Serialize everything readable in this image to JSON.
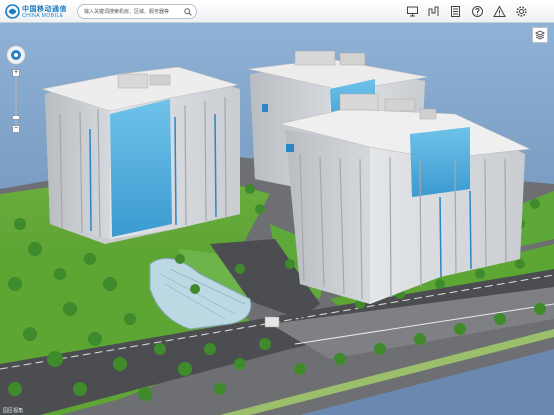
{
  "brand": {
    "name_cn": "中国移动通信",
    "name_en": "CHINA MOBILE",
    "color": "#1a7bc1"
  },
  "search": {
    "placeholder": "输入关键词搜索机房、区域、服务器等",
    "icon": "search-icon"
  },
  "toolbar": {
    "tools": [
      {
        "name": "monitor-icon",
        "symbol": "monitor"
      },
      {
        "name": "chart-icon",
        "symbol": "chart"
      },
      {
        "name": "document-icon",
        "symbol": "document"
      },
      {
        "name": "help-icon",
        "symbol": "help"
      },
      {
        "name": "warning-icon",
        "symbol": "warning"
      },
      {
        "name": "settings-icon",
        "symbol": "settings"
      }
    ]
  },
  "layers": {
    "icon": "layers-icon"
  },
  "navigation": {
    "zoom_in": "+",
    "zoom_out": "−"
  },
  "status_text": "园区视角"
}
